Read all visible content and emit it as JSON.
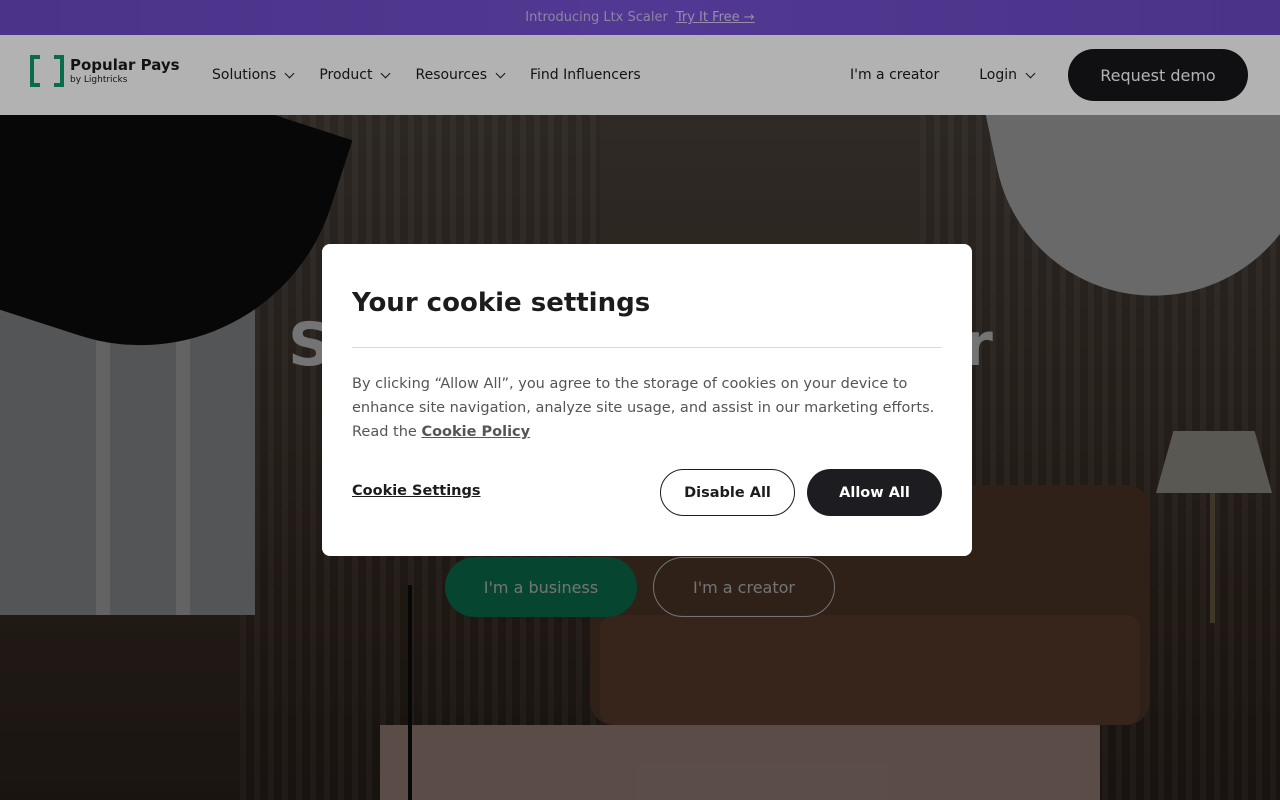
{
  "announcement": {
    "text": "Introducing Ltx Scaler",
    "cta": "Try It Free →"
  },
  "nav": {
    "logo": {
      "name": "Popular Pays",
      "sub": "by Lightricks"
    },
    "menu": [
      {
        "label": "Solutions",
        "dropdown": true
      },
      {
        "label": "Product",
        "dropdown": true
      },
      {
        "label": "Resources",
        "dropdown": true
      },
      {
        "label": "Find Influencers",
        "dropdown": false
      }
    ],
    "creator_link": "I'm a creator",
    "login": "Login",
    "request_demo": "Request demo"
  },
  "hero": {
    "title": "Str                           er",
    "business_button": "I'm a business",
    "creator_button": "I'm a creator"
  },
  "cookie_modal": {
    "title": "Your cookie settings",
    "body": "By clicking “Allow All”, you agree to the storage of cookies on your device to enhance site navigation, analyze site usage, and assist in our marketing efforts. Read the",
    "policy_link": "Cookie Policy",
    "settings_link": "Cookie Settings",
    "disable_all": "Disable All",
    "allow_all": "Allow All"
  },
  "colors": {
    "brand_green": "#0f9a6c",
    "announce_purple": "#6a4bc4",
    "dark_button": "#18181c"
  }
}
